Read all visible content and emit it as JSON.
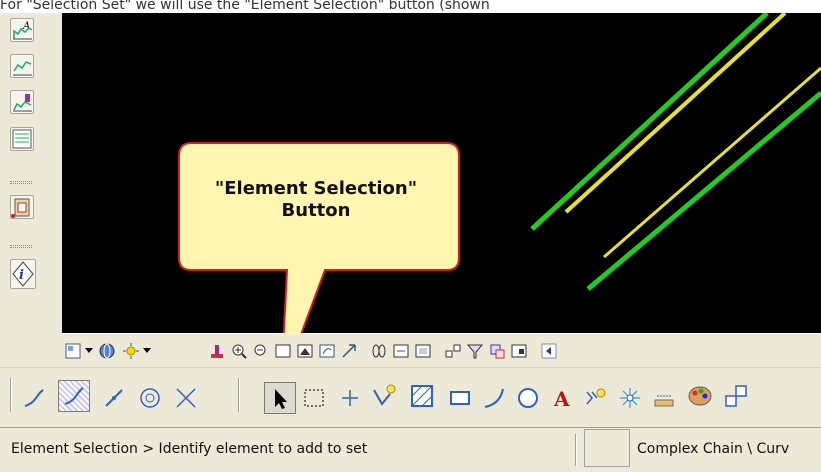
{
  "caption": {
    "text": "For \"Selection Set\" we will use the \"Element Selection\" button (shown"
  },
  "callout": {
    "line1": "\"Element Selection\"",
    "line2": "Button"
  },
  "left_toolbar": {
    "icons": [
      "text-style-icon",
      "chart-green-icon",
      "chart-purple-icon",
      "report-icon",
      "clipboard-icon",
      "info-icon"
    ]
  },
  "status_bar": {
    "prompt": "Element Selection > Identify element to add to set",
    "right_text": "Complex Chain \\ Curv"
  },
  "colors": {
    "green": "#22cc22",
    "yellow": "#e8e030",
    "canvas": "#000000",
    "callout_fill": "#fdf5b0",
    "callout_border": "#d02020"
  }
}
